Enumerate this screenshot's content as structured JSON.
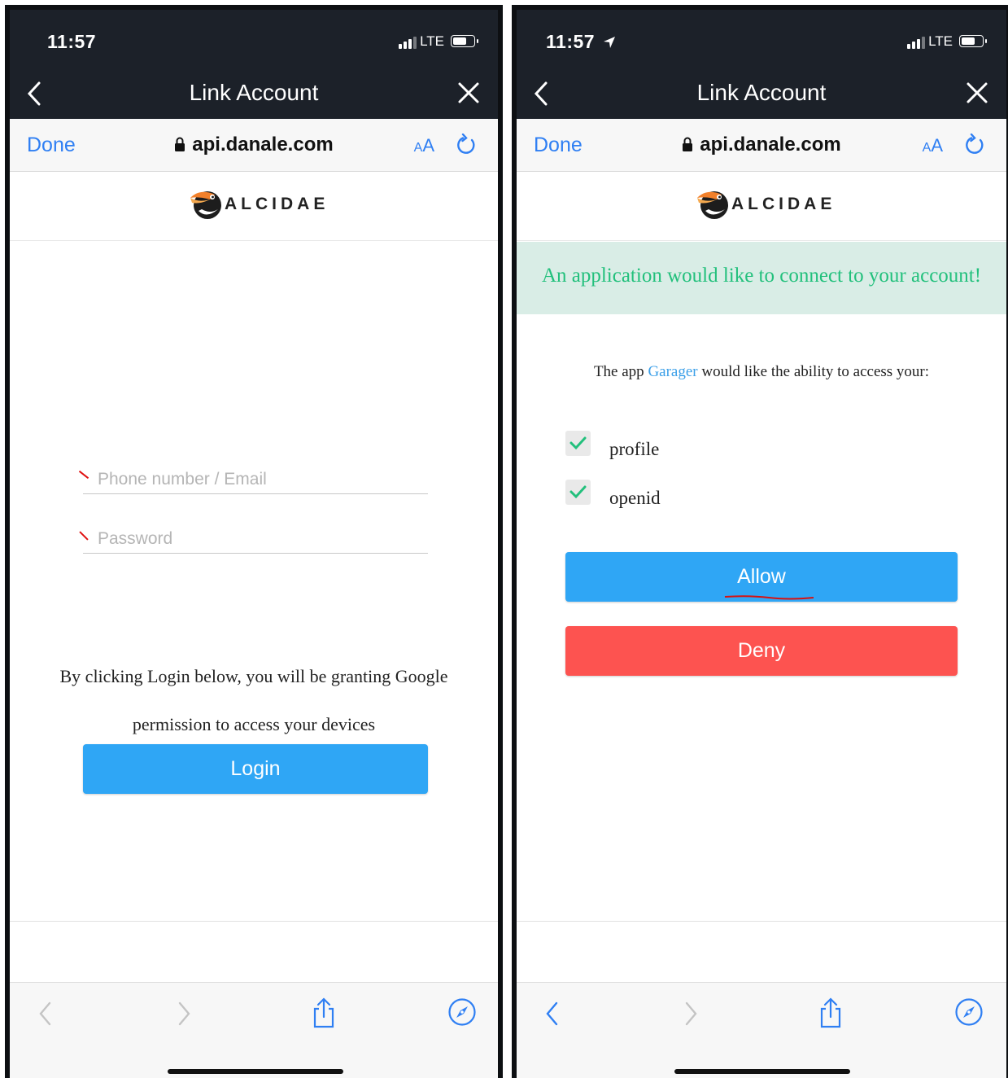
{
  "left": {
    "status": {
      "time": "11:57",
      "network": "LTE"
    },
    "nav": {
      "title": "Link Account"
    },
    "browser": {
      "done": "Done",
      "url": "api.danale.com",
      "text_size_small": "A",
      "text_size_big": "A"
    },
    "logo": {
      "text": "ALCIDAE"
    },
    "form": {
      "phone_placeholder": "Phone number / Email",
      "password_placeholder": "Password",
      "notice_line1": "By clicking Login below, you will be granting Google",
      "notice_line2": "permission to access your devices",
      "login_label": "Login"
    }
  },
  "right": {
    "status": {
      "time": "11:57",
      "network": "LTE"
    },
    "nav": {
      "title": "Link Account"
    },
    "browser": {
      "done": "Done",
      "url": "api.danale.com",
      "text_size_small": "A",
      "text_size_big": "A"
    },
    "logo": {
      "text": "ALCIDAE"
    },
    "banner": "An application would like to connect to your account!",
    "request": {
      "prefix": "The app",
      "app_name": "Garager",
      "suffix": "would like the ability to access your:"
    },
    "scopes": [
      "profile",
      "openid"
    ],
    "allow_label": "Allow",
    "deny_label": "Deny"
  },
  "colors": {
    "accent": "#2fa6f5",
    "deny": "#fd5350",
    "success": "#22c07c",
    "nav_bg": "#1c2129"
  }
}
